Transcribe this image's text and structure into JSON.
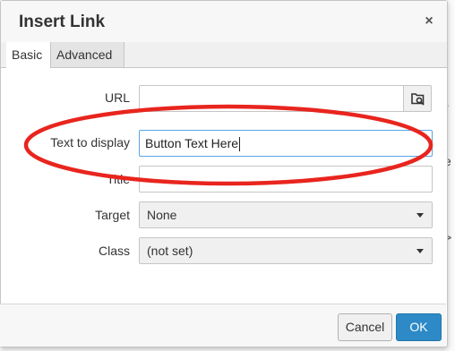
{
  "dialog": {
    "title": "Insert Link",
    "close_symbol": "×"
  },
  "tabs": [
    {
      "label": "Basic",
      "active": true
    },
    {
      "label": "Advanced",
      "active": false
    }
  ],
  "form": {
    "url": {
      "label": "URL",
      "value": ""
    },
    "text_to_display": {
      "label": "Text to display",
      "value": "Button Text Here"
    },
    "title": {
      "label": "Title",
      "value": ""
    },
    "target": {
      "label": "Target",
      "selected": "None"
    },
    "class": {
      "label": "Class",
      "selected": "(not set)"
    }
  },
  "buttons": {
    "cancel": "Cancel",
    "ok": "OK"
  },
  "icons": {
    "browse": "browse-icon",
    "dropdown": "chevron-down-icon"
  },
  "colors": {
    "annotation": "#e8251e",
    "primary": "#2d8ac7",
    "focus": "#59a5e5"
  }
}
